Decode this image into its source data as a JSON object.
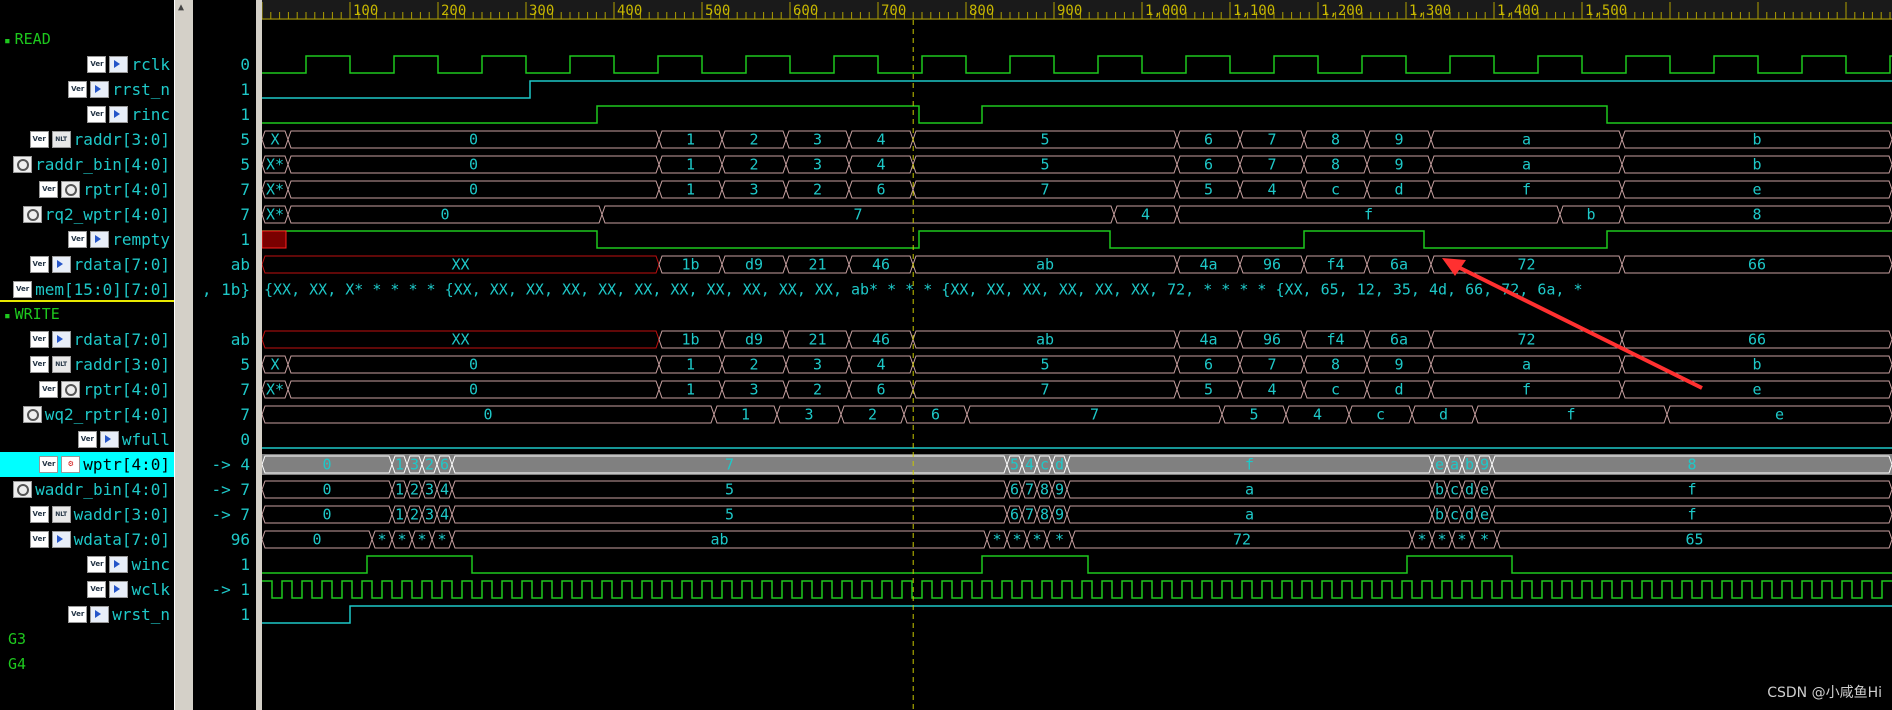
{
  "groups": [
    {
      "name": "READ",
      "row": 1
    },
    {
      "name": "WRITE",
      "row": 12
    },
    {
      "name": "G3",
      "row": 25
    },
    {
      "name": "G4",
      "row": 26
    }
  ],
  "signals": [
    {
      "row": 2,
      "name": "rclk",
      "icons": [
        "ver",
        "dir"
      ],
      "value": "0"
    },
    {
      "row": 3,
      "name": "rrst_n",
      "icons": [
        "ver",
        "dir"
      ],
      "value": "1"
    },
    {
      "row": 4,
      "name": "rinc",
      "icons": [
        "ver",
        "dir"
      ],
      "value": "1"
    },
    {
      "row": 5,
      "name": "raddr[3:0]",
      "icons": [
        "ver",
        "nlt"
      ],
      "value": "5"
    },
    {
      "row": 6,
      "name": "raddr_bin[4:0]",
      "icons": [
        "wire"
      ],
      "value": "5"
    },
    {
      "row": 7,
      "name": "rptr[4:0]",
      "icons": [
        "ver",
        "wire"
      ],
      "value": "7"
    },
    {
      "row": 8,
      "name": "rq2_wptr[4:0]",
      "icons": [
        "wire"
      ],
      "value": "7"
    },
    {
      "row": 9,
      "name": "rempty",
      "icons": [
        "ver",
        "dir"
      ],
      "value": "1"
    },
    {
      "row": 10,
      "name": "rdata[7:0]",
      "icons": [
        "ver",
        "dir"
      ],
      "value": "ab"
    },
    {
      "row": 11,
      "name": "mem[15:0][7:0]",
      "icons": [
        "ver"
      ],
      "value": ", 1b}"
    },
    {
      "row": 13,
      "name": "rdata[7:0]",
      "icons": [
        "ver",
        "dir"
      ],
      "value": "ab"
    },
    {
      "row": 14,
      "name": "raddr[3:0]",
      "icons": [
        "ver",
        "nlt"
      ],
      "value": "5"
    },
    {
      "row": 15,
      "name": "rptr[4:0]",
      "icons": [
        "ver",
        "wire"
      ],
      "value": "7"
    },
    {
      "row": 16,
      "name": "wq2_rptr[4:0]",
      "icons": [
        "wire"
      ],
      "value": "7"
    },
    {
      "row": 17,
      "name": "wfull",
      "icons": [
        "ver",
        "dir"
      ],
      "value": "0"
    },
    {
      "row": 18,
      "name": "wptr[4:0]",
      "icons": [
        "ver",
        "reg"
      ],
      "value": "-> 4",
      "selected": true
    },
    {
      "row": 19,
      "name": "waddr_bin[4:0]",
      "icons": [
        "wire"
      ],
      "value": "-> 7"
    },
    {
      "row": 20,
      "name": "waddr[3:0]",
      "icons": [
        "ver",
        "nlt"
      ],
      "value": "-> 7"
    },
    {
      "row": 21,
      "name": "wdata[7:0]",
      "icons": [
        "ver",
        "dir"
      ],
      "value": "96"
    },
    {
      "row": 22,
      "name": "winc",
      "icons": [
        "ver",
        "dir"
      ],
      "value": "1"
    },
    {
      "row": 23,
      "name": "wclk",
      "icons": [
        "ver",
        "dir"
      ],
      "value": "-> 1"
    },
    {
      "row": 24,
      "name": "wrst_n",
      "icons": [
        "ver",
        "dir"
      ],
      "value": "1"
    }
  ],
  "icon_labels": {
    "ver": "Ver",
    "nlt": "NLT",
    "reg": "⚙"
  },
  "ruler": {
    "ticks": [
      "100",
      "200",
      "300",
      "400",
      "500",
      "600",
      "700",
      "800",
      "900",
      "1,000",
      "1,100",
      "1,200",
      "1,300",
      "1,400",
      "1,500"
    ]
  },
  "cursor_time": 740,
  "waves": {
    "rclk": {
      "type": "clock",
      "period": 88,
      "first_high": 0,
      "start_low": true
    },
    "wclk": {
      "type": "clock",
      "period": 20,
      "first_high": 0
    },
    "rrst_n": {
      "type": "bit",
      "color": "#1ec8c8",
      "edges": [
        [
          0,
          0
        ],
        [
          268,
          1
        ]
      ]
    },
    "rinc": {
      "type": "bit",
      "color": "#1ec81e",
      "edges": [
        [
          0,
          0
        ],
        [
          335,
          1
        ],
        [
          657,
          0
        ],
        [
          720,
          1
        ],
        [
          1345,
          0
        ]
      ]
    },
    "rempty": {
      "type": "bit",
      "color": "#1ec81e",
      "edges": [
        [
          0,
          1
        ],
        [
          335,
          0
        ],
        [
          657,
          1
        ],
        [
          848,
          0
        ],
        [
          1042,
          1
        ],
        [
          1162,
          0
        ],
        [
          1345,
          1
        ]
      ]
    },
    "winc": {
      "type": "bit",
      "color": "#1ec81e",
      "edges": [
        [
          0,
          0
        ],
        [
          105,
          1
        ],
        [
          210,
          0
        ],
        [
          720,
          1
        ],
        [
          826,
          0
        ],
        [
          1145,
          1
        ],
        [
          1250,
          0
        ]
      ]
    },
    "wrst_n": {
      "type": "bit",
      "color": "#1ec8c8",
      "edges": [
        [
          0,
          0
        ],
        [
          88,
          1
        ]
      ]
    },
    "wfull": {
      "type": "bit",
      "color": "#1ec8c8",
      "edges": [
        [
          0,
          0
        ]
      ]
    },
    "raddr": {
      "type": "bus",
      "segs": [
        [
          0,
          26,
          "X"
        ],
        [
          26,
          397,
          "0"
        ],
        [
          397,
          460,
          "1"
        ],
        [
          460,
          524,
          "2"
        ],
        [
          524,
          587,
          "3"
        ],
        [
          587,
          651,
          "4"
        ],
        [
          651,
          915,
          "5"
        ],
        [
          915,
          978,
          "6"
        ],
        [
          978,
          1042,
          "7"
        ],
        [
          1042,
          1105,
          "8"
        ],
        [
          1105,
          1169,
          "9"
        ],
        [
          1169,
          1360,
          "a"
        ],
        [
          1360,
          1630,
          "b"
        ]
      ]
    },
    "raddr_bin": {
      "type": "bus",
      "segs": [
        [
          0,
          26,
          "X*"
        ],
        [
          26,
          397,
          "0"
        ],
        [
          397,
          460,
          "1"
        ],
        [
          460,
          524,
          "2"
        ],
        [
          524,
          587,
          "3"
        ],
        [
          587,
          651,
          "4"
        ],
        [
          651,
          915,
          "5"
        ],
        [
          915,
          978,
          "6"
        ],
        [
          978,
          1042,
          "7"
        ],
        [
          1042,
          1105,
          "8"
        ],
        [
          1105,
          1169,
          "9"
        ],
        [
          1169,
          1360,
          "a"
        ],
        [
          1360,
          1630,
          "b"
        ]
      ]
    },
    "rptr": {
      "type": "bus",
      "segs": [
        [
          0,
          26,
          "X*"
        ],
        [
          26,
          397,
          "0"
        ],
        [
          397,
          460,
          "1"
        ],
        [
          460,
          524,
          "3"
        ],
        [
          524,
          587,
          "2"
        ],
        [
          587,
          651,
          "6"
        ],
        [
          651,
          915,
          "7"
        ],
        [
          915,
          978,
          "5"
        ],
        [
          978,
          1042,
          "4"
        ],
        [
          1042,
          1105,
          "c"
        ],
        [
          1105,
          1169,
          "d"
        ],
        [
          1169,
          1360,
          "f"
        ],
        [
          1360,
          1630,
          "e"
        ]
      ]
    },
    "rq2_wptr": {
      "type": "bus",
      "segs": [
        [
          0,
          26,
          "X*"
        ],
        [
          26,
          340,
          "0"
        ],
        [
          340,
          852,
          "7"
        ],
        [
          852,
          915,
          "4"
        ],
        [
          915,
          1298,
          "f"
        ],
        [
          1298,
          1360,
          "b"
        ],
        [
          1360,
          1630,
          "8"
        ]
      ]
    },
    "rdata_r": {
      "type": "bus",
      "red_until": 397,
      "segs": [
        [
          0,
          397,
          "XX"
        ],
        [
          397,
          460,
          "1b"
        ],
        [
          460,
          524,
          "d9"
        ],
        [
          524,
          587,
          "21"
        ],
        [
          587,
          651,
          "46"
        ],
        [
          651,
          915,
          "ab"
        ],
        [
          915,
          978,
          "4a"
        ],
        [
          978,
          1042,
          "96"
        ],
        [
          1042,
          1105,
          "f4"
        ],
        [
          1105,
          1169,
          "6a"
        ],
        [
          1169,
          1360,
          "72"
        ],
        [
          1360,
          1630,
          "66"
        ]
      ]
    },
    "mem": {
      "type": "text",
      "text": "{XX, XX, X* * * * * {XX, XX, XX, XX, XX, XX, XX, XX, XX, XX, XX, ab* * * * {XX, XX, XX, XX, XX, XX, 72, * * * * {XX, 65, 12, 35, 4d, 66, 72, 6a, *"
    },
    "rdata_w": {
      "type": "bus",
      "red_until": 397,
      "segs": [
        [
          0,
          397,
          "XX"
        ],
        [
          397,
          460,
          "1b"
        ],
        [
          460,
          524,
          "d9"
        ],
        [
          524,
          587,
          "21"
        ],
        [
          587,
          651,
          "46"
        ],
        [
          651,
          915,
          "ab"
        ],
        [
          915,
          978,
          "4a"
        ],
        [
          978,
          1042,
          "96"
        ],
        [
          1042,
          1105,
          "f4"
        ],
        [
          1105,
          1169,
          "6a"
        ],
        [
          1169,
          1360,
          "72"
        ],
        [
          1360,
          1630,
          "66"
        ]
      ]
    },
    "raddr_w": {
      "type": "bus",
      "segs": [
        [
          0,
          26,
          "X"
        ],
        [
          26,
          397,
          "0"
        ],
        [
          397,
          460,
          "1"
        ],
        [
          460,
          524,
          "2"
        ],
        [
          524,
          587,
          "3"
        ],
        [
          587,
          651,
          "4"
        ],
        [
          651,
          915,
          "5"
        ],
        [
          915,
          978,
          "6"
        ],
        [
          978,
          1042,
          "7"
        ],
        [
          1042,
          1105,
          "8"
        ],
        [
          1105,
          1169,
          "9"
        ],
        [
          1169,
          1360,
          "a"
        ],
        [
          1360,
          1630,
          "b"
        ]
      ]
    },
    "rptr_w": {
      "type": "bus",
      "segs": [
        [
          0,
          26,
          "X*"
        ],
        [
          26,
          397,
          "0"
        ],
        [
          397,
          460,
          "1"
        ],
        [
          460,
          524,
          "3"
        ],
        [
          524,
          587,
          "2"
        ],
        [
          587,
          651,
          "6"
        ],
        [
          651,
          915,
          "7"
        ],
        [
          915,
          978,
          "5"
        ],
        [
          978,
          1042,
          "4"
        ],
        [
          1042,
          1105,
          "c"
        ],
        [
          1105,
          1169,
          "d"
        ],
        [
          1169,
          1360,
          "f"
        ],
        [
          1360,
          1630,
          "e"
        ]
      ]
    },
    "wq2_rptr": {
      "type": "bus",
      "segs": [
        [
          0,
          452,
          "0"
        ],
        [
          452,
          515,
          "1"
        ],
        [
          515,
          579,
          "3"
        ],
        [
          579,
          642,
          "2"
        ],
        [
          642,
          705,
          "6"
        ],
        [
          705,
          960,
          "7"
        ],
        [
          960,
          1024,
          "5"
        ],
        [
          1024,
          1087,
          "4"
        ],
        [
          1087,
          1150,
          "c"
        ],
        [
          1150,
          1213,
          "d"
        ],
        [
          1213,
          1405,
          "f"
        ],
        [
          1405,
          1630,
          "e"
        ]
      ]
    },
    "wptr": {
      "type": "bus",
      "sel": true,
      "segs": [
        [
          0,
          130,
          "0"
        ],
        [
          130,
          145,
          "1"
        ],
        [
          145,
          160,
          "3"
        ],
        [
          160,
          175,
          "2"
        ],
        [
          175,
          190,
          "6"
        ],
        [
          190,
          745,
          "7"
        ],
        [
          745,
          760,
          "5"
        ],
        [
          760,
          775,
          "4"
        ],
        [
          775,
          790,
          "c"
        ],
        [
          790,
          805,
          "d"
        ],
        [
          805,
          1170,
          "f"
        ],
        [
          1170,
          1185,
          "e"
        ],
        [
          1185,
          1200,
          "a"
        ],
        [
          1200,
          1215,
          "b"
        ],
        [
          1215,
          1230,
          "9"
        ],
        [
          1230,
          1630,
          "8"
        ]
      ]
    },
    "waddr_bin": {
      "type": "bus",
      "segs": [
        [
          0,
          130,
          "0"
        ],
        [
          130,
          145,
          "1"
        ],
        [
          145,
          160,
          "2"
        ],
        [
          160,
          175,
          "3"
        ],
        [
          175,
          190,
          "4"
        ],
        [
          190,
          745,
          "5"
        ],
        [
          745,
          760,
          "6"
        ],
        [
          760,
          775,
          "7"
        ],
        [
          775,
          790,
          "8"
        ],
        [
          790,
          805,
          "9"
        ],
        [
          805,
          1170,
          "a"
        ],
        [
          1170,
          1185,
          "b"
        ],
        [
          1185,
          1200,
          "c"
        ],
        [
          1200,
          1215,
          "d"
        ],
        [
          1215,
          1230,
          "e"
        ],
        [
          1230,
          1630,
          "f"
        ]
      ]
    },
    "waddr": {
      "type": "bus",
      "segs": [
        [
          0,
          130,
          "0"
        ],
        [
          130,
          145,
          "1"
        ],
        [
          145,
          160,
          "2"
        ],
        [
          160,
          175,
          "3"
        ],
        [
          175,
          190,
          "4"
        ],
        [
          190,
          745,
          "5"
        ],
        [
          745,
          760,
          "6"
        ],
        [
          760,
          775,
          "7"
        ],
        [
          775,
          790,
          "8"
        ],
        [
          790,
          805,
          "9"
        ],
        [
          805,
          1170,
          "a"
        ],
        [
          1170,
          1185,
          "b"
        ],
        [
          1185,
          1200,
          "c"
        ],
        [
          1200,
          1215,
          "d"
        ],
        [
          1215,
          1230,
          "e"
        ],
        [
          1230,
          1630,
          "f"
        ]
      ]
    },
    "wdata": {
      "type": "bus",
      "segs": [
        [
          0,
          110,
          "0"
        ],
        [
          110,
          130,
          "*"
        ],
        [
          130,
          150,
          "*"
        ],
        [
          150,
          170,
          "*"
        ],
        [
          170,
          190,
          "*"
        ],
        [
          190,
          725,
          "ab"
        ],
        [
          725,
          745,
          "*"
        ],
        [
          745,
          765,
          "*"
        ],
        [
          765,
          785,
          "*"
        ],
        [
          785,
          810,
          "*"
        ],
        [
          810,
          1150,
          "72"
        ],
        [
          1150,
          1170,
          "*"
        ],
        [
          1170,
          1190,
          "*"
        ],
        [
          1190,
          1210,
          "*"
        ],
        [
          1210,
          1235,
          "*"
        ],
        [
          1235,
          1630,
          "65"
        ]
      ]
    }
  },
  "wave_rows": {
    "rclk": 2,
    "rrst_n": 3,
    "rinc": 4,
    "raddr": 5,
    "raddr_bin": 6,
    "rptr": 7,
    "rq2_wptr": 8,
    "rempty": 9,
    "rdata_r": 10,
    "mem": 11,
    "rdata_w": 13,
    "raddr_w": 14,
    "rptr_w": 15,
    "wq2_rptr": 16,
    "wfull": 17,
    "wptr": 18,
    "waddr_bin": 19,
    "waddr": 20,
    "wdata": 21,
    "winc": 22,
    "wclk": 23,
    "wrst_n": 24
  },
  "annotation": {
    "color": "#ff3030"
  },
  "watermark": "CSDN @小咸鱼Hi"
}
